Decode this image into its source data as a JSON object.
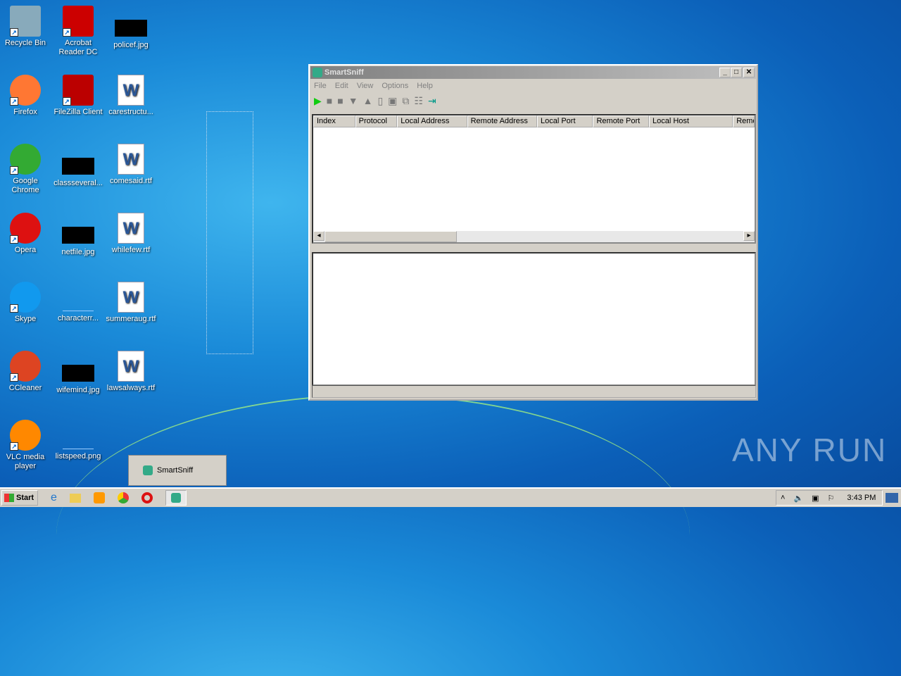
{
  "desktop": {
    "icons": [
      [
        "Recycle Bin",
        "Acrobat Reader DC",
        "policef.jpg"
      ],
      [
        "Firefox",
        "FileZilla Client",
        "carestructu..."
      ],
      [
        "Google Chrome",
        "classseveral...",
        "comesaid.rtf"
      ],
      [
        "Opera",
        "netfile.jpg",
        "whilefew.rtf"
      ],
      [
        "Skype",
        "characterr...",
        "summeraug.rtf"
      ],
      [
        "CCleaner",
        "wifemind.jpg",
        "lawsalways.rtf"
      ],
      [
        "VLC media player",
        "listspeed.png",
        ""
      ]
    ]
  },
  "window": {
    "title": "SmartSniff",
    "menu": [
      "File",
      "Edit",
      "View",
      "Options",
      "Help"
    ],
    "columns": [
      "Index",
      "Protocol",
      "Local Address",
      "Remote Address",
      "Local Port",
      "Remote Port",
      "Local Host",
      "Remo"
    ]
  },
  "tooltip": "SmartSniff",
  "taskbar": {
    "start": "Start",
    "clock": "3:43 PM"
  },
  "watermark": "ANY RUN"
}
